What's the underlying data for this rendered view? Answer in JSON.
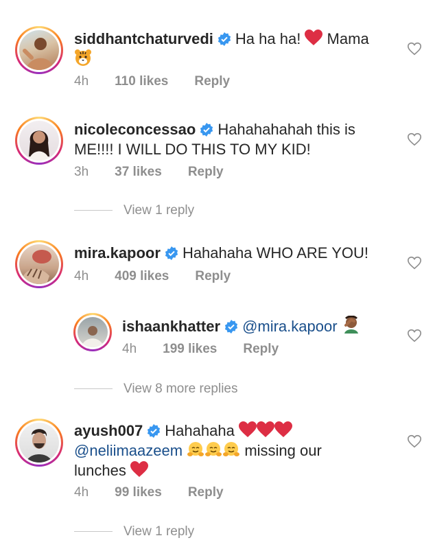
{
  "comments": [
    {
      "username": "siddhantchaturvedi",
      "text_lines": [
        "Ha ha ha! ",
        " Mama"
      ],
      "time": "4h",
      "likes": "110 likes",
      "reply": "Reply"
    },
    {
      "username": "nicoleconcessao",
      "text_line1": "Hahahahahah this is",
      "text_line2": "ME!!!! I WILL DO THIS TO MY KID!",
      "time": "3h",
      "likes": "37 likes",
      "reply": "Reply",
      "view_replies": "View 1 reply"
    },
    {
      "username": "mira.kapoor",
      "text": "Hahahaha WHO ARE YOU!",
      "time": "4h",
      "likes": "409 likes",
      "reply": "Reply",
      "reply_item": {
        "username": "ishaankhatter",
        "mention": "@mira.kapoor",
        "time": "4h",
        "likes": "199 likes",
        "reply": "Reply"
      },
      "view_replies": "View 8 more replies"
    },
    {
      "username": "ayush007",
      "text_line1": "Hahahaha",
      "mention": "@neliimaazeem",
      "text_line2_rest": "missing our",
      "text_line3": "lunches",
      "time": "4h",
      "likes": "99 likes",
      "reply": "Reply",
      "view_replies": "View 1 reply"
    }
  ],
  "icons": {
    "verified": "verified-badge-icon",
    "heart": "heart-outline-icon",
    "red_heart": "red-heart-emoji",
    "tiger": "tiger-face-emoji",
    "facepalm": "facepalm-emoji",
    "hug": "hugging-face-emoji"
  },
  "colors": {
    "verified": "#3897f0",
    "heart_red": "#e0245e",
    "meta_gray": "#8e8e8e"
  }
}
